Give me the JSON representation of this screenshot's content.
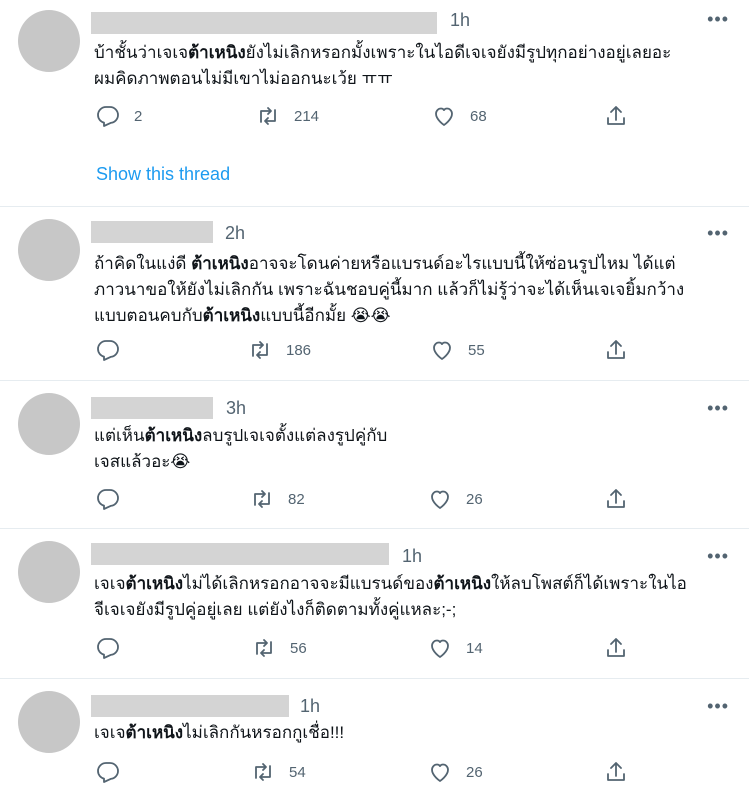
{
  "tweets": [
    {
      "time": "1h",
      "text_parts": [
        {
          "t": "บ้าชั้นว่าเจเจ",
          "b": false
        },
        {
          "t": "ต้าเหนิง",
          "b": true
        },
        {
          "t": "ยังไม่เลิกหรอกมั้งเพราะในไอดีเจเจยังมีรูปทุกอย่างอยู่เลยอะ\nผมคิดภาพตอนไม่มีเขาไม่ออกนะเว้ย ㅠㅠ",
          "b": false
        }
      ],
      "replies": "2",
      "retweets": "214",
      "likes": "68",
      "show_thread": "Show this thread"
    },
    {
      "time": "2h",
      "text_parts": [
        {
          "t": "ถ้าคิดในแง่ดี ",
          "b": false
        },
        {
          "t": "ต้าเหนิง",
          "b": true
        },
        {
          "t": "อาจจะโดนค่ายหรือแบรนด์อะไรแบบนี้ให้ซ่อนรูปไหม ได้แต่\nภาวนาขอให้ยังไม่เลิกกัน เพราะฉันชอบคู่นี้มาก แล้วก็ไม่รู้ว่าจะได้เห็นเจเจยิ้มกว้าง\nแบบตอนคบกับ",
          "b": false
        },
        {
          "t": "ต้าเหนิง",
          "b": true
        },
        {
          "t": "แบบนี้อีกมั้ย 😭😭",
          "b": false
        }
      ],
      "replies": "",
      "retweets": "186",
      "likes": "55"
    },
    {
      "time": "3h",
      "text_parts": [
        {
          "t": "แต่เห็น",
          "b": false
        },
        {
          "t": "ต้าเหนิง",
          "b": true
        },
        {
          "t": "ลบรูปเจเจตั้งแต่ลงรูปคู่กับ\nเจสแล้วอะ😭",
          "b": false
        }
      ],
      "replies": "",
      "retweets": "82",
      "likes": "26"
    },
    {
      "time": "1h",
      "text_parts": [
        {
          "t": "เจเจ",
          "b": false
        },
        {
          "t": "ต้าเหนิง",
          "b": true
        },
        {
          "t": "ไม่ได้เลิกหรอกอาจจะมีแบรนด์ของ",
          "b": false
        },
        {
          "t": "ต้าเหนิง",
          "b": true
        },
        {
          "t": "ให้ลบโพสต์ก็ได้เพราะในไอ\nจีเจเจยังมีรูปคู่อยู่เลย แต่ยังไงก็ติดตามทั้งคู่แหละ;-;",
          "b": false
        }
      ],
      "replies": "",
      "retweets": "56",
      "likes": "14"
    },
    {
      "time": "1h",
      "text_parts": [
        {
          "t": "เจเจ",
          "b": false
        },
        {
          "t": "ต้าเหนิง",
          "b": true
        },
        {
          "t": "ไม่เลิกกันหรอกกูเชื่อ!!!",
          "b": false
        }
      ],
      "replies": "",
      "retweets": "54",
      "likes": "26"
    }
  ],
  "colors": {
    "accent": "#1d9bf0",
    "muted": "#536471",
    "placeholder": "#c7c7c7"
  },
  "icons": [
    "reply-icon",
    "retweet-icon",
    "like-icon",
    "share-icon",
    "more-icon"
  ]
}
